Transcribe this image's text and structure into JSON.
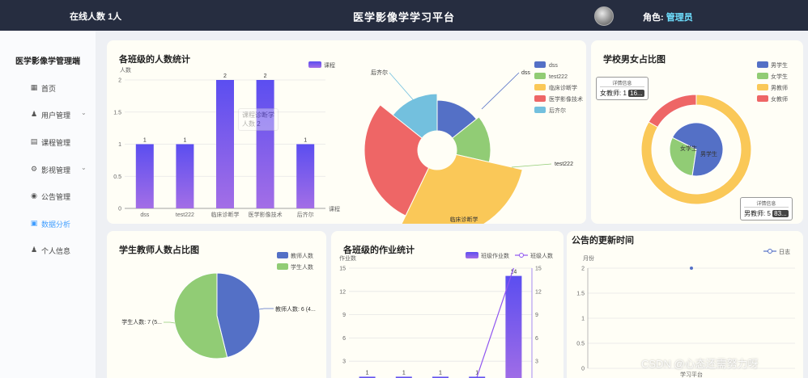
{
  "header": {
    "online_label": "在线人数",
    "online_count": "1人",
    "title": "医学影像学学习平台",
    "role_label": "角色:",
    "role_value": "管理员"
  },
  "sidebar": {
    "brand": "医学影像学管理端",
    "items": [
      {
        "label": "首页",
        "icon": "home-grid-icon"
      },
      {
        "label": "用户管理",
        "icon": "user-icon",
        "has_submenu": true
      },
      {
        "label": "课程管理",
        "icon": "document-icon"
      },
      {
        "label": "影视管理",
        "icon": "gear-icon",
        "has_submenu": true
      },
      {
        "label": "公告管理",
        "icon": "pin-icon"
      },
      {
        "label": "数据分析",
        "icon": "chart-icon",
        "active": true
      },
      {
        "label": "个人信息",
        "icon": "person-icon"
      }
    ]
  },
  "cards": {
    "class_count": {
      "title": "各班级的人数统计"
    },
    "class_pie": {
      "title": ""
    },
    "gender": {
      "title": "学校男女占比图"
    },
    "teacher_student": {
      "title": "学生教师人数占比图"
    },
    "homework": {
      "title": "各班级的作业统计"
    },
    "notice": {
      "title": "公告的更新时间"
    }
  },
  "tooltips": {
    "gender_top": {
      "header": "详情信息",
      "text": "女教师: 1",
      "value": "16..."
    },
    "gender_bottom": {
      "header": "详情信息",
      "text": "男教师: 5",
      "value": "83..."
    },
    "class_bar_ghost": {
      "text": "课程诊断学",
      "text2": "人数 2"
    }
  },
  "watermark": "CSDN @心态还需努力呀",
  "colors": {
    "blue": "#5470c6",
    "green": "#91cc75",
    "yellow": "#fac858",
    "red": "#ee6666",
    "cyan": "#73c0de",
    "purple_top": "#5b4ef0",
    "purple_bottom": "#a36ee6"
  },
  "chart_data": [
    {
      "type": "bar",
      "title": "各班级的人数统计",
      "ylabel": "人数",
      "xlabel": "课程",
      "legend": [
        "课程"
      ],
      "categories": [
        "dss",
        "test222",
        "临床诊断学",
        "医学影像技术",
        "后齐尔"
      ],
      "values": [
        1,
        1,
        2,
        2,
        1
      ],
      "ylim": [
        0,
        2
      ],
      "yticks": [
        "0",
        "0.5",
        "1",
        "1.5",
        "2"
      ]
    },
    {
      "type": "pie",
      "variant": "rose",
      "legend": [
        "dss",
        "test222",
        "临床诊断学",
        "医学影像技术",
        "后齐尔"
      ],
      "values": [
        1,
        1,
        2,
        2,
        1
      ],
      "labels": [
        "dss",
        "test222",
        "临床诊断学",
        "",
        "后齐尔"
      ]
    },
    {
      "type": "pie",
      "title": "学校男女占比图",
      "inner": {
        "names": [
          "女学生",
          "男学生"
        ],
        "values": [
          3,
          7
        ]
      },
      "outer": {
        "names": [
          "男教师",
          "女教师"
        ],
        "values": [
          5,
          1
        ]
      },
      "legend": [
        "男学生",
        "女学生",
        "男教师",
        "女教师"
      ]
    },
    {
      "type": "pie",
      "title": "学生教师人数占比图",
      "legend": [
        "教师人数",
        "学生人数"
      ],
      "values": [
        6,
        7
      ],
      "labels": [
        "教师人数: 6 (4...",
        "学生人数: 7 (5..."
      ]
    },
    {
      "type": "bar",
      "title": "各班级的作业统计",
      "legend": [
        "班级作业数",
        "班级人数"
      ],
      "ylabel": "作业数",
      "ylim": [
        0,
        15
      ],
      "yticks": [
        "3",
        "6",
        "9",
        "12",
        "15"
      ],
      "bar_values": [
        1,
        1,
        1,
        1,
        14
      ],
      "line_values": [
        1,
        1,
        1,
        1,
        15
      ]
    },
    {
      "type": "line",
      "title": "公告的更新时间",
      "legend": [
        "日志"
      ],
      "ylabel": "月份",
      "xlabel": "学习平台",
      "ylim": [
        0,
        2
      ],
      "yticks": [
        "0",
        "0.5",
        "1",
        "1.5",
        "2"
      ],
      "values": [
        2
      ]
    }
  ]
}
